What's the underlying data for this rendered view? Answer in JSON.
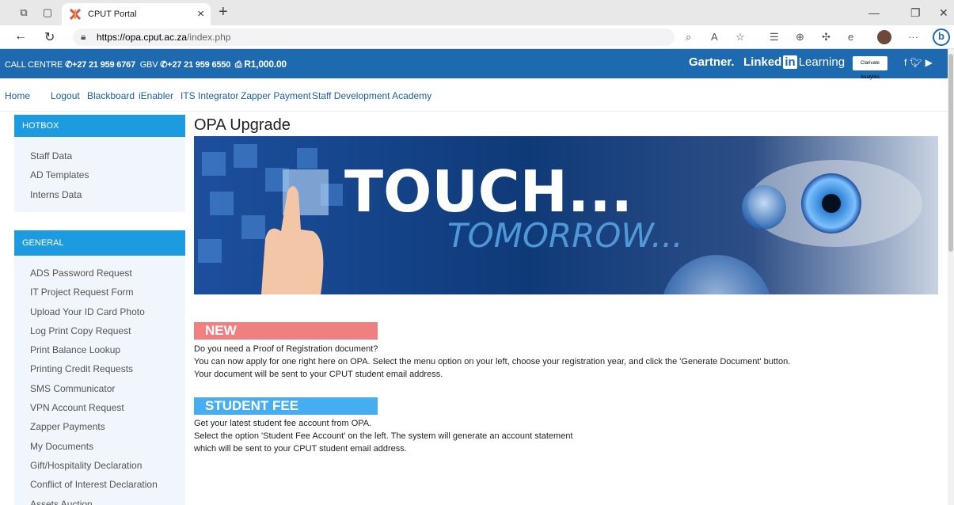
{
  "browser": {
    "tab_title": "CPUT Portal",
    "url_host": "https://opa.cput.ac.za",
    "url_path": "/index.php"
  },
  "topbar": {
    "call_centre_label": "CALL CENTRE",
    "call_centre_number": "+27 21 959 6767",
    "gbv_label": "GBV",
    "gbv_number": "+27 21 959 6550",
    "print_balance": "R1,000.00",
    "gartner": "Gartner.",
    "linkedin_a": "Linked",
    "linkedin_b": "in",
    "linkedin_c": "Learning",
    "clarivate": "Clarivate Analytics"
  },
  "menu": {
    "items": [
      "Home",
      "Logout",
      "Blackboard",
      "iEnabler",
      "ITS Integrator",
      "Zapper Payment",
      "Staff Development Academy"
    ]
  },
  "sidebar": {
    "hotbox": {
      "title": "HOTBOX",
      "items": [
        "Staff Data",
        "AD Templates",
        "Interns Data"
      ]
    },
    "general": {
      "title": "GENERAL",
      "items": [
        "ADS Password Request",
        "IT Project Request Form",
        "Upload Your ID Card Photo",
        "Log Print Copy Request",
        "Print Balance Lookup",
        "Printing Credit Requests",
        "SMS Communicator",
        "VPN Account Request",
        "Zapper Payments",
        "My Documents",
        "Gift/Hospitality Declaration",
        "Conflict of Interest Declaration",
        "Assets Auction"
      ]
    }
  },
  "main": {
    "title": "OPA Upgrade",
    "banner_line1": "TOUCH...",
    "banner_line2": "TOMORROW...",
    "new_badge": "NEW",
    "new_lines": [
      "Do you need a Proof of Registration document?",
      "You can now apply for one right here on OPA. Select the menu option on your left, choose your registration year, and click the 'Generate Document' button.",
      "Your document will be sent to your CPUT student email address."
    ],
    "fee_badge": "STUDENT FEE ACCOUNT",
    "fee_lines": [
      "Get your latest student fee account from OPA.",
      "Select the option 'Student Fee Account' on the left. The system will generate an account statement",
      "which will be sent to your CPUT student email address."
    ]
  },
  "colors": {
    "topbar": "#1e6ab0",
    "panel_head": "#1d9be0",
    "new_badge": "#f08080",
    "fee_badge": "#46aef0"
  }
}
